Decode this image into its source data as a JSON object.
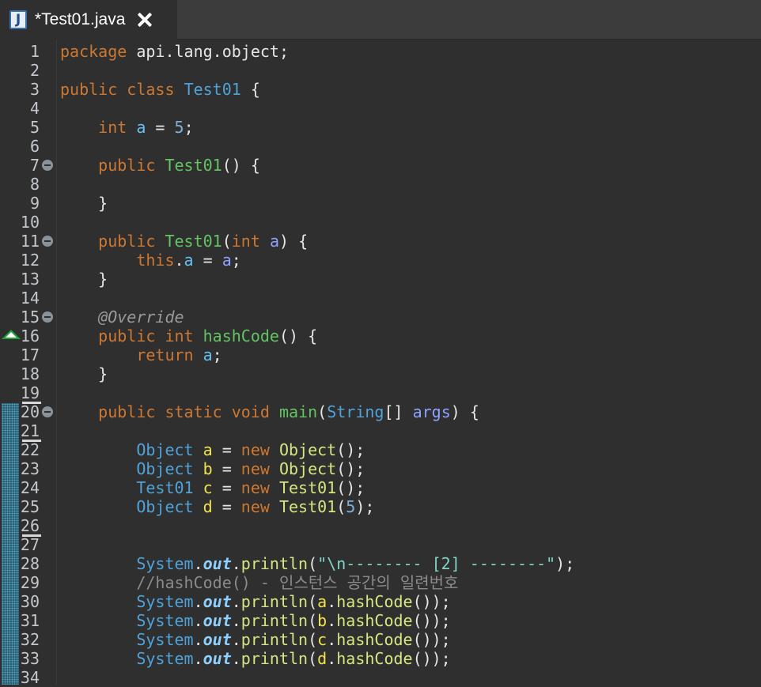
{
  "tab": {
    "title": "*Test01.java",
    "icon": "java-file-icon",
    "icon_letter": "J"
  },
  "colors": {
    "keyword": "#cc7832",
    "type": "#4fa3d8",
    "method_decl": "#62c462",
    "method_call": "#d6e680",
    "field": "#66c1f0",
    "param": "#8fa2ff",
    "local": "#f3e34a",
    "string": "#7fd6c7",
    "comment": "#8b8b8b",
    "background": "#2f2f2f"
  },
  "lines": [
    {
      "n": "1",
      "tokens": [
        [
          "kw",
          "package"
        ],
        [
          "pl",
          " api.lang.object;"
        ]
      ]
    },
    {
      "n": "2",
      "tokens": []
    },
    {
      "n": "3",
      "tokens": [
        [
          "kw",
          "public"
        ],
        [
          "pl",
          " "
        ],
        [
          "kw",
          "class"
        ],
        [
          "pl",
          " "
        ],
        [
          "cls",
          "Test01"
        ],
        [
          "pl",
          " {"
        ]
      ]
    },
    {
      "n": "4",
      "tokens": []
    },
    {
      "n": "5",
      "tokens": [
        [
          "pl",
          "    "
        ],
        [
          "kw",
          "int"
        ],
        [
          "pl",
          " "
        ],
        [
          "fld",
          "a"
        ],
        [
          "pl",
          " = "
        ],
        [
          "num",
          "5"
        ],
        [
          "pl",
          ";"
        ]
      ]
    },
    {
      "n": "6",
      "tokens": []
    },
    {
      "n": "7",
      "fold": true,
      "tokens": [
        [
          "pl",
          "    "
        ],
        [
          "kw",
          "public"
        ],
        [
          "pl",
          " "
        ],
        [
          "mth",
          "Test01"
        ],
        [
          "pl",
          "() {"
        ]
      ]
    },
    {
      "n": "8",
      "tokens": []
    },
    {
      "n": "9",
      "tokens": [
        [
          "pl",
          "    }"
        ]
      ]
    },
    {
      "n": "10",
      "tokens": []
    },
    {
      "n": "11",
      "fold": true,
      "tokens": [
        [
          "pl",
          "    "
        ],
        [
          "kw",
          "public"
        ],
        [
          "pl",
          " "
        ],
        [
          "mth",
          "Test01"
        ],
        [
          "pl",
          "("
        ],
        [
          "kw",
          "int"
        ],
        [
          "pl",
          " "
        ],
        [
          "prm",
          "a"
        ],
        [
          "pl",
          ") {"
        ]
      ]
    },
    {
      "n": "12",
      "tokens": [
        [
          "pl",
          "        "
        ],
        [
          "kw",
          "this"
        ],
        [
          "pl",
          "."
        ],
        [
          "fld",
          "a"
        ],
        [
          "pl",
          " = "
        ],
        [
          "prm",
          "a"
        ],
        [
          "pl",
          ";"
        ]
      ]
    },
    {
      "n": "13",
      "tokens": [
        [
          "pl",
          "    }"
        ]
      ]
    },
    {
      "n": "14",
      "tokens": []
    },
    {
      "n": "15",
      "fold": true,
      "tokens": [
        [
          "pl",
          "    "
        ],
        [
          "ann",
          "@Override"
        ]
      ]
    },
    {
      "n": "16",
      "override": true,
      "tokens": [
        [
          "pl",
          "    "
        ],
        [
          "kw",
          "public"
        ],
        [
          "pl",
          " "
        ],
        [
          "kw",
          "int"
        ],
        [
          "pl",
          " "
        ],
        [
          "mth",
          "hashCode"
        ],
        [
          "pl",
          "() {"
        ]
      ]
    },
    {
      "n": "17",
      "tokens": [
        [
          "pl",
          "        "
        ],
        [
          "kw",
          "return"
        ],
        [
          "pl",
          " "
        ],
        [
          "fld",
          "a"
        ],
        [
          "pl",
          ";"
        ]
      ]
    },
    {
      "n": "18",
      "tokens": [
        [
          "pl",
          "    }"
        ]
      ]
    },
    {
      "n": "19",
      "tokens": []
    },
    {
      "n": "20",
      "fold": true,
      "tokens": [
        [
          "pl",
          "    "
        ],
        [
          "kw",
          "public"
        ],
        [
          "pl",
          " "
        ],
        [
          "kw",
          "static"
        ],
        [
          "pl",
          " "
        ],
        [
          "kw",
          "void"
        ],
        [
          "pl",
          " "
        ],
        [
          "mth",
          "main"
        ],
        [
          "pl",
          "("
        ],
        [
          "ty",
          "String"
        ],
        [
          "pl",
          "[] "
        ],
        [
          "prm",
          "args"
        ],
        [
          "pl",
          ") {"
        ]
      ]
    },
    {
      "n": "21",
      "tokens": []
    },
    {
      "n": "22",
      "tokens": [
        [
          "pl",
          "        "
        ],
        [
          "ty",
          "Object"
        ],
        [
          "pl",
          " "
        ],
        [
          "loc",
          "a"
        ],
        [
          "pl",
          " = "
        ],
        [
          "kw",
          "new"
        ],
        [
          "pl",
          " "
        ],
        [
          "call",
          "Object"
        ],
        [
          "pl",
          "();"
        ]
      ]
    },
    {
      "n": "23",
      "tokens": [
        [
          "pl",
          "        "
        ],
        [
          "ty",
          "Object"
        ],
        [
          "pl",
          " "
        ],
        [
          "loc",
          "b"
        ],
        [
          "pl",
          " = "
        ],
        [
          "kw",
          "new"
        ],
        [
          "pl",
          " "
        ],
        [
          "call",
          "Object"
        ],
        [
          "pl",
          "();"
        ]
      ]
    },
    {
      "n": "24",
      "tokens": [
        [
          "pl",
          "        "
        ],
        [
          "ty",
          "Test01"
        ],
        [
          "pl",
          " "
        ],
        [
          "loc",
          "c"
        ],
        [
          "pl",
          " = "
        ],
        [
          "kw",
          "new"
        ],
        [
          "pl",
          " "
        ],
        [
          "call",
          "Test01"
        ],
        [
          "pl",
          "();"
        ]
      ]
    },
    {
      "n": "25",
      "tokens": [
        [
          "pl",
          "        "
        ],
        [
          "ty",
          "Object"
        ],
        [
          "pl",
          " "
        ],
        [
          "loc",
          "d"
        ],
        [
          "pl",
          " = "
        ],
        [
          "kw",
          "new"
        ],
        [
          "pl",
          " "
        ],
        [
          "call",
          "Test01"
        ],
        [
          "pl",
          "("
        ],
        [
          "num",
          "5"
        ],
        [
          "pl",
          ");"
        ]
      ]
    },
    {
      "n": "26",
      "tokens": []
    },
    {
      "n": "27",
      "tokens": []
    },
    {
      "n": "28",
      "tokens": [
        [
          "pl",
          "        "
        ],
        [
          "ty",
          "System"
        ],
        [
          "pl",
          "."
        ],
        [
          "stf",
          "out"
        ],
        [
          "pl",
          "."
        ],
        [
          "call",
          "println"
        ],
        [
          "pl",
          "("
        ],
        [
          "str",
          "\"\\n-------- [2] --------\""
        ],
        [
          "pl",
          ");"
        ]
      ]
    },
    {
      "n": "29",
      "tokens": [
        [
          "pl",
          "        "
        ],
        [
          "cmt",
          "//hashCode() - 인스턴스 공간의 일련번호"
        ]
      ]
    },
    {
      "n": "30",
      "tokens": [
        [
          "pl",
          "        "
        ],
        [
          "ty",
          "System"
        ],
        [
          "pl",
          "."
        ],
        [
          "stf",
          "out"
        ],
        [
          "pl",
          "."
        ],
        [
          "call",
          "println"
        ],
        [
          "pl",
          "("
        ],
        [
          "loc",
          "a"
        ],
        [
          "pl",
          "."
        ],
        [
          "call",
          "hashCode"
        ],
        [
          "pl",
          "());"
        ]
      ]
    },
    {
      "n": "31",
      "tokens": [
        [
          "pl",
          "        "
        ],
        [
          "ty",
          "System"
        ],
        [
          "pl",
          "."
        ],
        [
          "stf",
          "out"
        ],
        [
          "pl",
          "."
        ],
        [
          "call",
          "println"
        ],
        [
          "pl",
          "("
        ],
        [
          "loc",
          "b"
        ],
        [
          "pl",
          "."
        ],
        [
          "call",
          "hashCode"
        ],
        [
          "pl",
          "());"
        ]
      ]
    },
    {
      "n": "32",
      "tokens": [
        [
          "pl",
          "        "
        ],
        [
          "ty",
          "System"
        ],
        [
          "pl",
          "."
        ],
        [
          "stf",
          "out"
        ],
        [
          "pl",
          "."
        ],
        [
          "call",
          "println"
        ],
        [
          "pl",
          "("
        ],
        [
          "loc",
          "c"
        ],
        [
          "pl",
          "."
        ],
        [
          "call",
          "hashCode"
        ],
        [
          "pl",
          "());"
        ]
      ]
    },
    {
      "n": "33",
      "tokens": [
        [
          "pl",
          "        "
        ],
        [
          "ty",
          "System"
        ],
        [
          "pl",
          "."
        ],
        [
          "stf",
          "out"
        ],
        [
          "pl",
          "."
        ],
        [
          "call",
          "println"
        ],
        [
          "pl",
          "("
        ],
        [
          "loc",
          "d"
        ],
        [
          "pl",
          "."
        ],
        [
          "call",
          "hashCode"
        ],
        [
          "pl",
          "());"
        ]
      ]
    },
    {
      "n": "34",
      "tokens": []
    }
  ]
}
